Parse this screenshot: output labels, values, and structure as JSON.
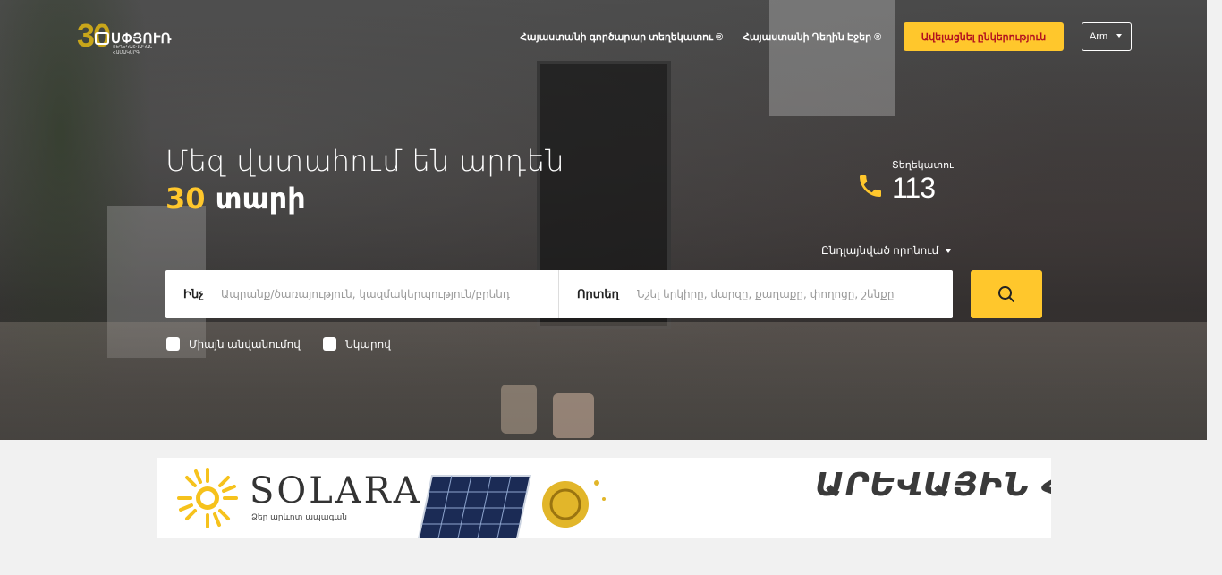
{
  "logo": {
    "anniversary": "30",
    "brand": "ՍՓՅՈՒՌ",
    "subtitle": "ՏԵՂԵԿԱՏՎԱԿԱՆ ՀԱՄԱԿԱՐԳ"
  },
  "nav": {
    "link1": "Հայաստանի գործարար տեղեկատու ®",
    "link2": "Հայաստանի Դեղին Էջեր ®",
    "cta": "Ավելացնել ընկերություն",
    "lang": "Arm"
  },
  "hero": {
    "line1": "Մեզ վստահում են արդեն",
    "years": "30",
    "years_word": "տարի"
  },
  "phone": {
    "label": "Տեղեկատու",
    "number": "113"
  },
  "advanced_search": "Ընդլայնված որոնում",
  "search": {
    "what_label": "Ինչ",
    "what_placeholder": "Ապրանք/ծառայություն, կազմակերպություն/բրենդ",
    "where_label": "Որտեղ",
    "where_placeholder": "Նշել երկիրը, մարզը, քաղաքը, փողոցը, շենքը"
  },
  "filters": {
    "by_name": "Միայն անվանումով",
    "with_photo": "Նկարով"
  },
  "banner": {
    "brand": "SOLARA",
    "tagline": "Ձեր արևոտ ապագան",
    "slogan": "ԱՐԵՎԱՅԻՆ ՀԱՐՎԱԾ"
  },
  "colors": {
    "accent": "#ffc72c",
    "cta_text": "#b3121f"
  }
}
